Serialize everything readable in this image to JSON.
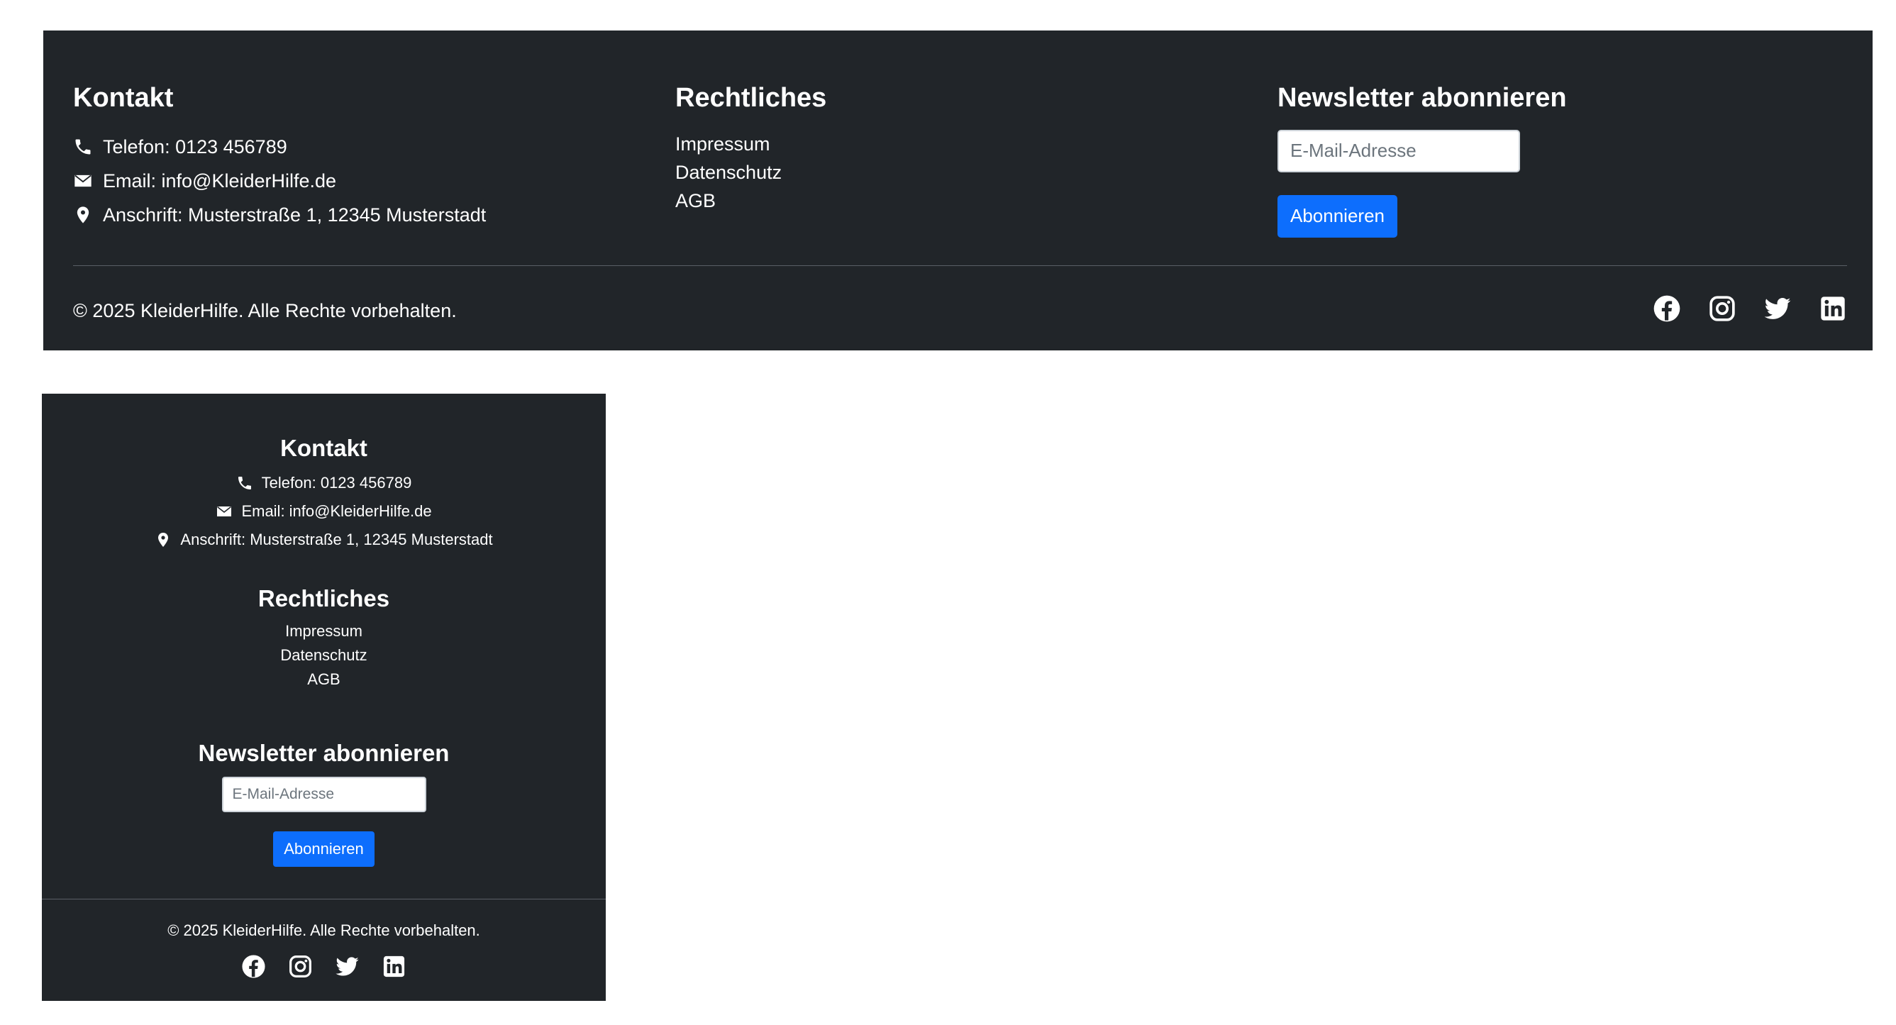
{
  "contact": {
    "heading": "Kontakt",
    "phone": "Telefon: 0123 456789",
    "email": "Email: info@KleiderHilfe.de",
    "address": "Anschrift: Musterstraße 1, 12345 Musterstadt"
  },
  "legal": {
    "heading": "Rechtliches",
    "links": [
      "Impressum",
      "Datenschutz",
      "AGB"
    ]
  },
  "newsletter": {
    "heading": "Newsletter abonnieren",
    "email_placeholder": "E-Mail-Adresse",
    "email_value": "",
    "subscribe_label": "Abonnieren"
  },
  "copyright": "© 2025 KleiderHilfe. Alle Rechte vorbehalten.",
  "social": {
    "icons": [
      "facebook-icon",
      "instagram-icon",
      "twitter-icon",
      "linkedin-icon"
    ]
  },
  "colors": {
    "footer_bg": "#212529",
    "text": "#ffffff",
    "button_bg": "#0d6efd",
    "divider": "#5a5f66"
  }
}
